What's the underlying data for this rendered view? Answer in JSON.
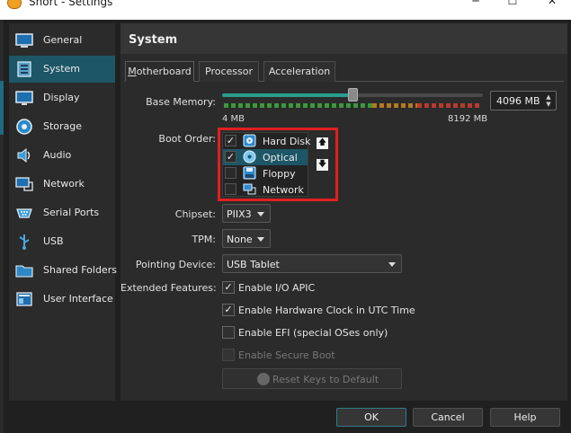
{
  "window": {
    "title": "Snort - Settings",
    "minimize_glyph": "─",
    "maximize_glyph": "☐",
    "close_glyph": "✕"
  },
  "sidebar": {
    "items": [
      {
        "label": "General",
        "icon": "general-icon"
      },
      {
        "label": "System",
        "icon": "system-icon",
        "active": true
      },
      {
        "label": "Display",
        "icon": "display-icon"
      },
      {
        "label": "Storage",
        "icon": "storage-icon"
      },
      {
        "label": "Audio",
        "icon": "audio-icon"
      },
      {
        "label": "Network",
        "icon": "network-icon"
      },
      {
        "label": "Serial Ports",
        "icon": "serial-ports-icon"
      },
      {
        "label": "USB",
        "icon": "usb-icon"
      },
      {
        "label": "Shared Folders",
        "icon": "shared-folders-icon"
      },
      {
        "label": "User Interface",
        "icon": "user-interface-icon"
      }
    ]
  },
  "page": {
    "heading": "System",
    "tabs": [
      {
        "label": "Motherboard",
        "active": true
      },
      {
        "label": "Processor"
      },
      {
        "label": "Acceleration"
      }
    ]
  },
  "motherboard": {
    "base_memory": {
      "label": "Base Memory:",
      "value": "4096 MB",
      "value_mb": 4096,
      "min_label": "4 MB",
      "max_label": "8192 MB",
      "min_mb": 4,
      "max_mb": 8192
    },
    "boot_order": {
      "label": "Boot Order:",
      "items": [
        {
          "label": "Hard Disk",
          "checked": true,
          "icon": "hard-disk-icon"
        },
        {
          "label": "Optical",
          "checked": true,
          "selected": true,
          "icon": "optical-disc-icon"
        },
        {
          "label": "Floppy",
          "checked": false,
          "icon": "floppy-icon"
        },
        {
          "label": "Network",
          "checked": false,
          "icon": "network-boot-icon"
        }
      ],
      "move_up_glyph": "🡅",
      "move_down_glyph": "🡇"
    },
    "chipset": {
      "label": "Chipset:",
      "value": "PIIX3"
    },
    "tpm": {
      "label": "TPM:",
      "value": "None"
    },
    "pointing_device": {
      "label": "Pointing Device:",
      "value": "USB Tablet"
    },
    "extended_features": {
      "label": "Extended Features:",
      "options": [
        {
          "label": "Enable I/O APIC",
          "checked": true,
          "enabled": true
        },
        {
          "label": "Enable Hardware Clock in UTC Time",
          "checked": true,
          "enabled": true
        },
        {
          "label": "Enable EFI (special OSes only)",
          "checked": false,
          "enabled": true
        },
        {
          "label": "Enable Secure Boot",
          "checked": false,
          "enabled": false
        }
      ]
    },
    "reset_keys_label": "Reset Keys to Default"
  },
  "footer": {
    "ok_label": "OK",
    "cancel_label": "Cancel",
    "help_label": "Help"
  },
  "check_glyph": "✓",
  "colors": {
    "accent": "#1d5667",
    "highlight_box": "#e02020",
    "slider_fill": "#2a9d8f",
    "scale_green": "#3a9a3a",
    "scale_orange": "#b87820",
    "scale_red": "#b83a2a"
  }
}
